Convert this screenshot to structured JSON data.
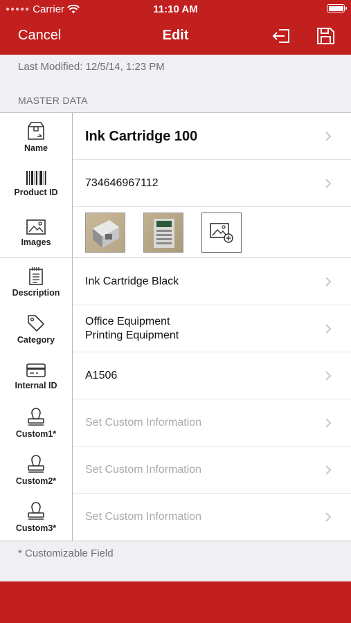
{
  "status_bar": {
    "carrier": "Carrier",
    "time": "11:10 AM"
  },
  "nav": {
    "cancel_label": "Cancel",
    "title": "Edit"
  },
  "last_modified": "Last Modified: 12/5/14, 1:23 PM",
  "section_header": "MASTER DATA",
  "rows": [
    {
      "label": "Name",
      "icon": "box-icon",
      "value": "Ink Cartridge 100"
    },
    {
      "label": "Product ID",
      "icon": "barcode-icon",
      "value": "734646967112"
    },
    {
      "label": "Images",
      "icon": "image-icon"
    },
    {
      "label": "Description",
      "icon": "notepad-icon",
      "value": "Ink Cartridge Black"
    },
    {
      "label": "Category",
      "icon": "tag-icon",
      "value_line1": "Office Equipment",
      "value_line2": "Printing Equipment"
    },
    {
      "label": "Internal ID",
      "icon": "card-icon",
      "value": "A1506"
    },
    {
      "label": "Custom1*",
      "icon": "stamp-icon",
      "placeholder": "Set Custom Information"
    },
    {
      "label": "Custom2*",
      "icon": "stamp-icon",
      "placeholder": "Set Custom Information"
    },
    {
      "label": "Custom3*",
      "icon": "stamp-icon",
      "placeholder": "Set Custom Information"
    }
  ],
  "footnote": "* Customizable Field",
  "colors": {
    "brand_red": "#c21f1f",
    "placeholder_gray": "#a9a9ae"
  }
}
